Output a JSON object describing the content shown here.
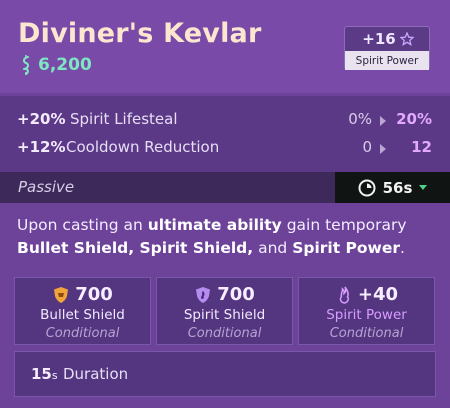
{
  "item": {
    "name": "Diviner's Kevlar",
    "cost": "6,200",
    "bonus_value": "+16",
    "bonus_label": "Spirit Power"
  },
  "stats": [
    {
      "value": "+20%",
      "label": "Spirit Lifesteal",
      "from": "0%",
      "to": "20%"
    },
    {
      "value": "+12%",
      "label": "Cooldown Reduction",
      "from": "0",
      "to": "12"
    }
  ],
  "passive": {
    "label": "Passive",
    "cooldown": "56s"
  },
  "description": {
    "t1": "Upon casting an ",
    "b1": "ultimate ability",
    "t2": " gain temporary ",
    "b2": "Bullet Shield, Spirit Shield,",
    "t3": " and ",
    "b3": "Spirit Power",
    "t4": "."
  },
  "properties": [
    {
      "icon": "bullet-shield-icon",
      "value": "700",
      "label": "Bullet Shield",
      "condition": "Conditional"
    },
    {
      "icon": "spirit-shield-icon",
      "value": "700",
      "label": "Spirit Shield",
      "condition": "Conditional"
    },
    {
      "icon": "spirit-power-icon",
      "value": "+40",
      "label": "Spirit Power",
      "condition": "Conditional"
    }
  ],
  "duration": {
    "value": "15",
    "unit": "s",
    "label": "Duration"
  },
  "colors": {
    "title": "#fbe6cf",
    "cost": "#7ee6c3",
    "spirit_accent": "#e3a8ff",
    "cooldown_bg": "#101513",
    "card_bg": "#6d4299"
  }
}
